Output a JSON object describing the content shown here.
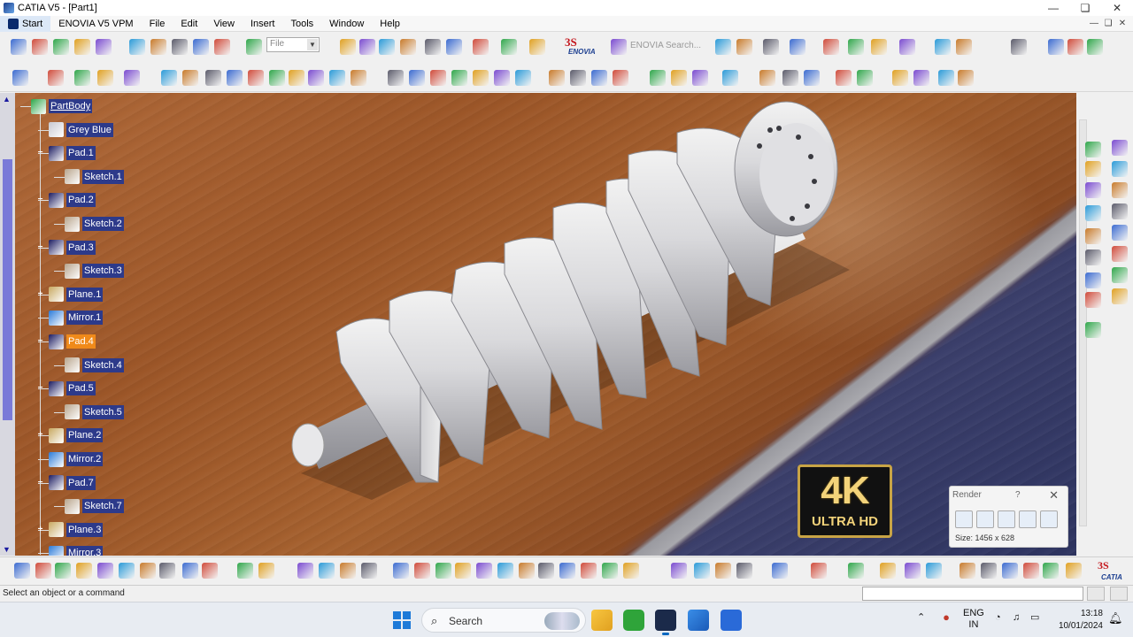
{
  "window": {
    "title": "CATIA V5 - [Part1]",
    "controls": [
      "—",
      "❏",
      "✕"
    ],
    "mdi_controls": [
      "—",
      "❏",
      "✕"
    ]
  },
  "menubar": {
    "items": [
      "Start",
      "ENOVIA V5 VPM",
      "File",
      "Edit",
      "View",
      "Insert",
      "Tools",
      "Window",
      "Help"
    ]
  },
  "toolbar": {
    "file_select": "File",
    "enovia_logo_mark": "3S",
    "enovia_logo_name": "ENOVIA",
    "enovia_search": "ENOVIA Search..."
  },
  "tree": {
    "nodes": [
      {
        "label": "PartBody",
        "icon": "partbody-icon",
        "color": "#2da64a"
      },
      {
        "label": "Grey Blue",
        "icon": "material-sphere-icon",
        "color": "#c8c8d0"
      },
      {
        "label": "Pad.1",
        "icon": "pad-icon",
        "color": "#1a1a60"
      },
      {
        "label": "Sketch.1",
        "icon": "sketch-icon",
        "color": "#b8a48c"
      },
      {
        "label": "Pad.2",
        "icon": "pad-icon",
        "color": "#1a1a60"
      },
      {
        "label": "Sketch.2",
        "icon": "sketch-icon",
        "color": "#b8a48c"
      },
      {
        "label": "Pad.3",
        "icon": "pad-icon",
        "color": "#1a1a60"
      },
      {
        "label": "Sketch.3",
        "icon": "sketch-icon",
        "color": "#b8a48c"
      },
      {
        "label": "Plane.1",
        "icon": "plane-icon",
        "color": "#c8a860"
      },
      {
        "label": "Mirror.1",
        "icon": "mirror-icon",
        "color": "#2a7ad8"
      },
      {
        "label": "Pad.4",
        "icon": "pad-icon",
        "color": "#1a1a60"
      },
      {
        "label": "Sketch.4",
        "icon": "sketch-icon",
        "color": "#b8a48c"
      },
      {
        "label": "Pad.5",
        "icon": "pad-icon",
        "color": "#1a1a60"
      },
      {
        "label": "Sketch.5",
        "icon": "sketch-icon",
        "color": "#b8a48c"
      },
      {
        "label": "Plane.2",
        "icon": "plane-icon",
        "color": "#c8a860"
      },
      {
        "label": "Mirror.2",
        "icon": "mirror-icon",
        "color": "#2a7ad8"
      },
      {
        "label": "Pad.7",
        "icon": "pad-icon",
        "color": "#1a1a60"
      },
      {
        "label": "Sketch.7",
        "icon": "sketch-icon",
        "color": "#b8a48c"
      },
      {
        "label": "Plane.3",
        "icon": "plane-icon",
        "color": "#c8a860"
      },
      {
        "label": "Mirror.3",
        "icon": "mirror-icon",
        "color": "#2a7ad8"
      }
    ],
    "selected": "Pad.4",
    "colors": {
      "label_bg": "#2d3a8a",
      "selected_bg": "#f08a1a"
    }
  },
  "badge": {
    "big": "4K",
    "small": "ULTRA HD"
  },
  "render_dialog": {
    "title": "Render",
    "help": "?",
    "close": "✕",
    "size": "Size: 1456 x 628"
  },
  "bottom_toolbar": {
    "catia_logo_mark": "3S",
    "catia_logo_name": "CATIA"
  },
  "statusbar": {
    "text": "Select an object or a command"
  },
  "taskbar": {
    "search_icon": "⌕",
    "search_label": "Search",
    "tray_chevron": "⌃",
    "lang_line1": "ENG",
    "lang_line2": "IN",
    "wifi": "◔",
    "volume": "♫",
    "battery": "▭",
    "time": "13:18",
    "date": "10/01/2024"
  }
}
